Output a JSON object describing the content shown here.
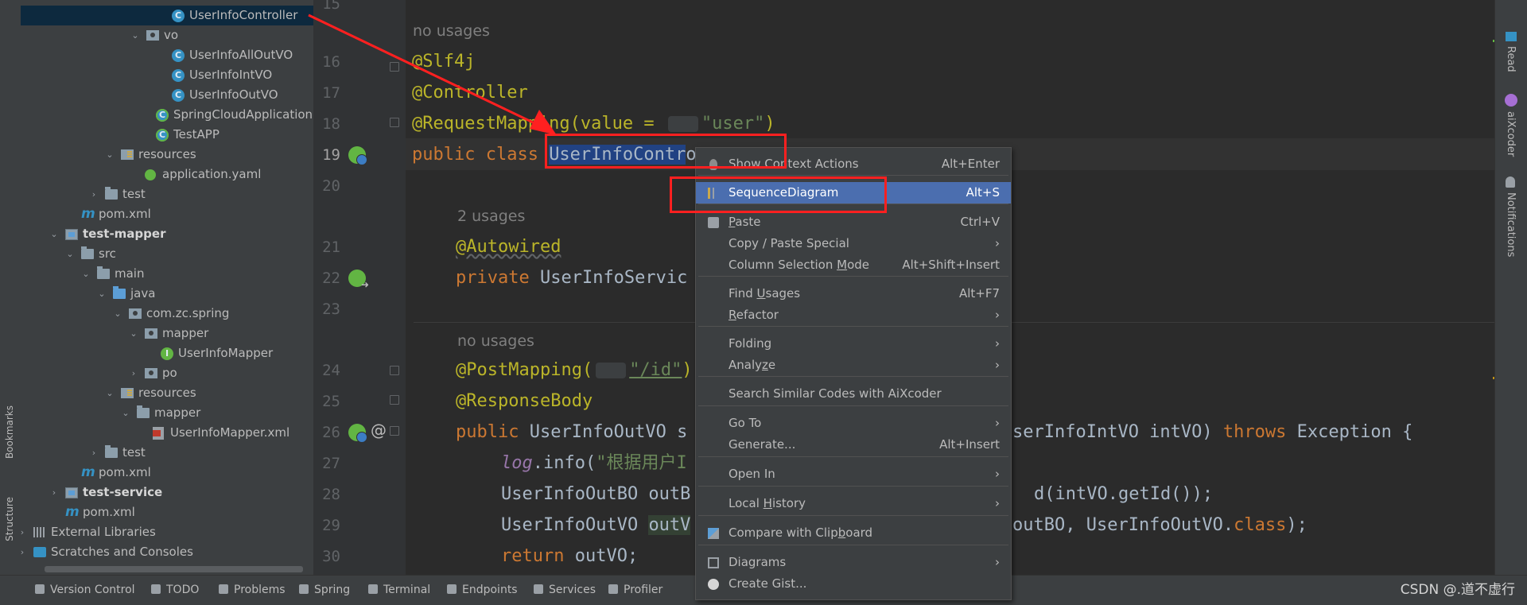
{
  "project_tree": [
    {
      "label": "UserInfoController",
      "icon": "class-icon",
      "selected": true
    },
    {
      "label": "vo",
      "icon": "package-folder-icon",
      "arrow": "down"
    },
    {
      "label": "UserInfoAllOutVO",
      "icon": "class-icon"
    },
    {
      "label": "UserInfoIntVO",
      "icon": "class-icon"
    },
    {
      "label": "UserInfoOutVO",
      "icon": "class-icon"
    },
    {
      "label": "SpringCloudApplication",
      "icon": "spring-class-icon"
    },
    {
      "label": "TestAPP",
      "icon": "spring-class-icon"
    },
    {
      "label": "resources",
      "icon": "resources-folder-icon",
      "arrow": "down"
    },
    {
      "label": "application.yaml",
      "icon": "yaml-icon"
    },
    {
      "label": "test",
      "icon": "folder-icon",
      "arrow": "right"
    },
    {
      "label": "pom.xml",
      "icon": "maven-icon"
    },
    {
      "label": "test-mapper",
      "icon": "module-icon",
      "arrow": "down",
      "bold": true
    },
    {
      "label": "src",
      "icon": "folder-icon",
      "arrow": "down"
    },
    {
      "label": "main",
      "icon": "folder-icon",
      "arrow": "down"
    },
    {
      "label": "java",
      "icon": "source-folder-icon",
      "arrow": "down"
    },
    {
      "label": "com.zc.spring",
      "icon": "package-folder-icon",
      "arrow": "down"
    },
    {
      "label": "mapper",
      "icon": "package-folder-icon",
      "arrow": "down"
    },
    {
      "label": "UserInfoMapper",
      "icon": "interface-icon"
    },
    {
      "label": "po",
      "icon": "package-folder-icon",
      "arrow": "right"
    },
    {
      "label": "resources",
      "icon": "resources-folder-icon",
      "arrow": "down"
    },
    {
      "label": "mapper",
      "icon": "folder-icon",
      "arrow": "down"
    },
    {
      "label": "UserInfoMapper.xml",
      "icon": "xml-icon"
    },
    {
      "label": "test",
      "icon": "folder-icon",
      "arrow": "right"
    },
    {
      "label": "pom.xml",
      "icon": "maven-icon"
    },
    {
      "label": "test-service",
      "icon": "module-icon",
      "arrow": "right",
      "bold": true
    },
    {
      "label": "pom.xml",
      "icon": "maven-icon"
    },
    {
      "label": "External Libraries",
      "icon": "library-icon",
      "arrow": "right"
    },
    {
      "label": "Scratches and Consoles",
      "icon": "scratch-icon",
      "arrow": "right"
    }
  ],
  "left_strip": {
    "bookmarks": "Bookmarks",
    "structure": "Structure"
  },
  "right_strip": {
    "read": "Read",
    "aixcoder": "aiXcoder",
    "notifications": "Notifications"
  },
  "gutter": {
    "line_numbers": [
      "15",
      "16",
      "17",
      "18",
      "19",
      "20",
      "21",
      "22",
      "23",
      "24",
      "25",
      "26",
      "27",
      "28",
      "29",
      "30"
    ],
    "at_symbol": "@"
  },
  "editor": {
    "hint_no_usages_1": "no usages",
    "line16": "@Slf4j",
    "line17": "@Controller",
    "line18_pre": "@RequestMapping(value = ",
    "line18_str": "\"user\"",
    "line18_post": ")",
    "line19_kw": "public class ",
    "line19_name": "UserInfoContr",
    "line19_tail": "o",
    "hint_2_usages": "2 usages",
    "line21": "@Autowired",
    "line22_kw": "private ",
    "line22_rest": "UserInfoServic",
    "hint_no_usages_2": "no usages",
    "line24_pre": "@PostMapping(",
    "line24_str": "\"/id\"",
    "line24_post": ")",
    "line25": "@ResponseBody",
    "line26_kw": "public ",
    "line26_a": "UserInfoOutVO s",
    "line26_b": "serInfoIntVO intVO) ",
    "line26_throws": "throws ",
    "line26_c": "Exception {",
    "line27_log": "log",
    "line27_rest": ".info(",
    "line27_str": "\"根据用户I",
    "line28_a": "UserInfoOutBO outB",
    "line28_b": "d(intVO.getId());",
    "line29_a": "UserInfoOutVO ",
    "line29_var": "outV",
    "line29_b": "outBO, UserInfoOutVO.",
    "line29_class": "class",
    "line29_end": ");",
    "line30_kw": "return ",
    "line30_rest": "outVO;"
  },
  "context_menu": {
    "items": [
      {
        "label": "Show Context Actions",
        "shortcut": "Alt+Enter",
        "icon": "lightbulb-icon"
      },
      {
        "label": "SequenceDiagram",
        "shortcut": "Alt+S",
        "icon": "sequence-diagram-icon",
        "active": true
      },
      {
        "label": "Paste",
        "shortcut": "Ctrl+V",
        "icon": "clipboard-icon",
        "underline": "P"
      },
      {
        "label": "Copy / Paste Special",
        "submenu": true
      },
      {
        "label": "Column Selection Mode",
        "shortcut": "Alt+Shift+Insert",
        "underline": "M"
      },
      {
        "label": "Find Usages",
        "shortcut": "Alt+F7",
        "underline": "U"
      },
      {
        "label": "Refactor",
        "submenu": true,
        "underline": "R"
      },
      {
        "label": "Folding",
        "submenu": true
      },
      {
        "label": "Analyze",
        "submenu": true,
        "underline": "z"
      },
      {
        "label": "Search Similar Codes with AiXcoder"
      },
      {
        "label": "Go To",
        "submenu": true
      },
      {
        "label": "Generate...",
        "shortcut": "Alt+Insert"
      },
      {
        "label": "Open In",
        "submenu": true
      },
      {
        "label": "Local History",
        "submenu": true,
        "underline": "H"
      },
      {
        "label": "Compare with Clipboard",
        "icon": "compare-icon",
        "underline": "b"
      },
      {
        "label": "Diagrams",
        "submenu": true,
        "icon": "diagram-icon"
      },
      {
        "label": "Create Gist...",
        "icon": "github-icon"
      }
    ],
    "submenu_arrow": "›"
  },
  "statusbar": {
    "items": [
      {
        "label": "Version Control",
        "icon": "version-control-icon"
      },
      {
        "label": "TODO",
        "icon": "todo-icon"
      },
      {
        "label": "Problems",
        "icon": "problems-icon"
      },
      {
        "label": "Spring",
        "icon": "spring-icon"
      },
      {
        "label": "Terminal",
        "icon": "terminal-icon"
      },
      {
        "label": "Endpoints",
        "icon": "endpoints-icon"
      },
      {
        "label": "Services",
        "icon": "services-icon"
      },
      {
        "label": "Profiler",
        "icon": "profiler-icon"
      }
    ],
    "watermark": "CSDN @.道不虚行"
  },
  "colors": {
    "annotation_red": "#ff2020",
    "menu_active": "#4b6eaf",
    "selection": "#0d293e"
  }
}
